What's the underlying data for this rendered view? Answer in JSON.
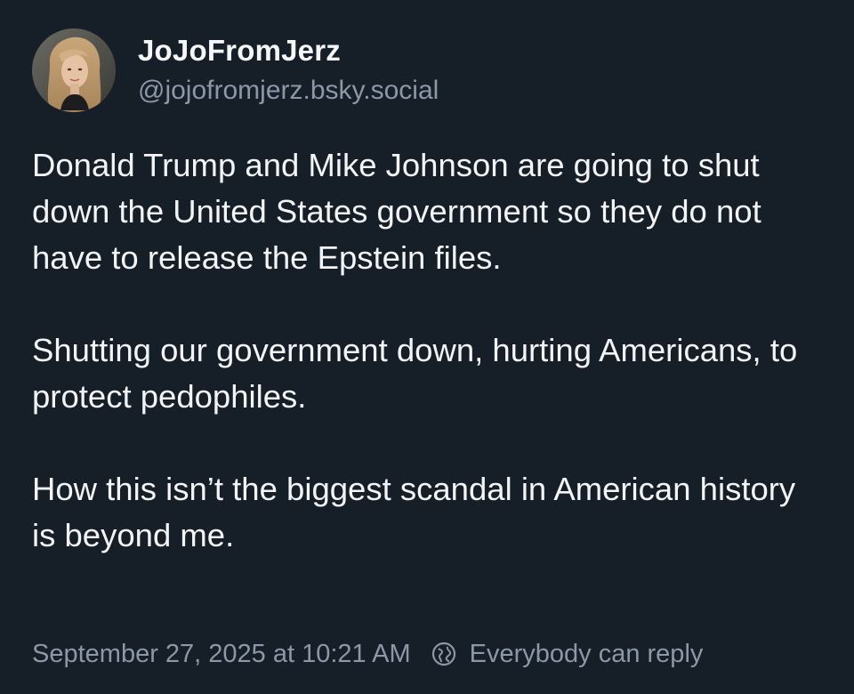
{
  "post": {
    "author": {
      "display_name": "JoJoFromJerz",
      "handle": "@jojofromjerz.bsky.social",
      "avatar_icon": "profile-photo"
    },
    "paragraphs": [
      "Donald Trump and Mike Johnson are going to shut down the United States government so they do not have to release the Epstein files.",
      "Shutting our government down, hurting Americans, to protect pedophiles.",
      "How this isn’t the biggest scandal in American history is beyond me."
    ],
    "timestamp": "September 27, 2025 at 10:21 AM",
    "reply_setting": {
      "icon": "globe-icon",
      "label": "Everybody can reply"
    }
  },
  "colors": {
    "background": "#161e27",
    "primary_text": "#f2f4f6",
    "secondary_text": "#8b98a8"
  }
}
